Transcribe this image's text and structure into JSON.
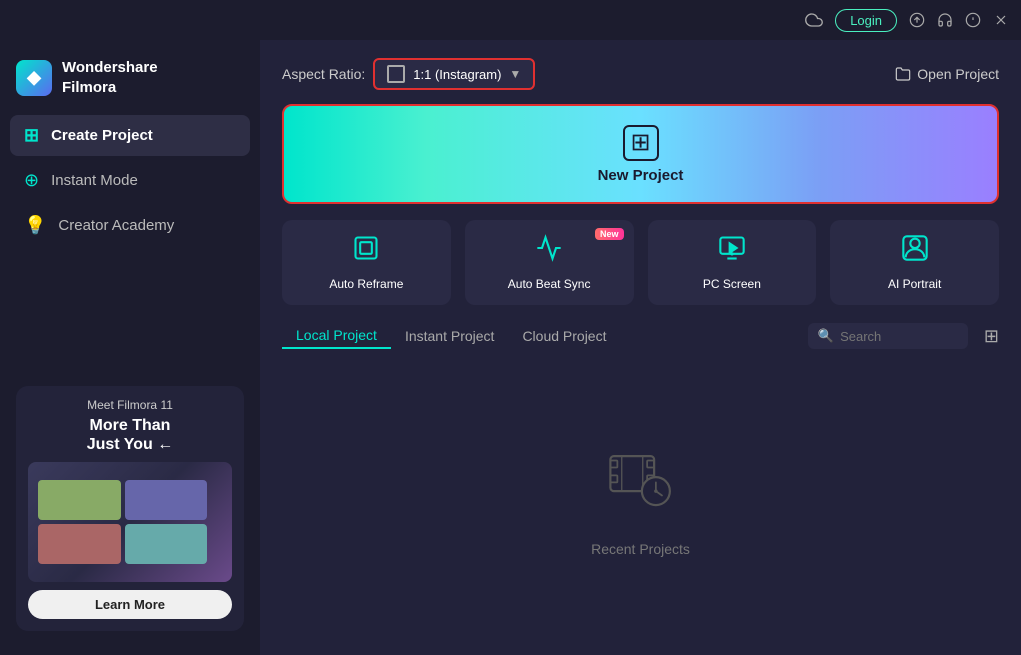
{
  "titlebar": {
    "login_label": "Login",
    "icons": [
      "cloud-icon",
      "upload-icon",
      "headset-icon",
      "alert-icon",
      "close-icon"
    ]
  },
  "sidebar": {
    "logo_text_line1": "Wondershare",
    "logo_text_line2": "Filmora",
    "nav_items": [
      {
        "id": "create-project",
        "label": "Create Project",
        "active": true
      },
      {
        "id": "instant-mode",
        "label": "Instant Mode",
        "active": false
      },
      {
        "id": "creator-academy",
        "label": "Creator Academy",
        "active": false
      }
    ],
    "promo": {
      "subtitle": "Meet Filmora 11",
      "headline": "More Than\nJust You",
      "learn_more_label": "Learn More"
    }
  },
  "content": {
    "aspect_ratio_label": "Aspect Ratio:",
    "aspect_ratio_value": "1:1 (Instagram)",
    "open_project_label": "Open Project",
    "new_project_label": "New Project",
    "quick_actions": [
      {
        "id": "auto-reframe",
        "label": "Auto Reframe",
        "icon": "reframe",
        "badge": null
      },
      {
        "id": "auto-beat-sync",
        "label": "Auto Beat Sync",
        "icon": "beat",
        "badge": "New"
      },
      {
        "id": "pc-screen",
        "label": "PC Screen",
        "icon": "screen",
        "badge": null
      },
      {
        "id": "ai-portrait",
        "label": "AI Portrait",
        "icon": "portrait",
        "badge": null
      }
    ],
    "project_tabs": [
      {
        "id": "local",
        "label": "Local Project",
        "active": true
      },
      {
        "id": "instant",
        "label": "Instant Project",
        "active": false
      },
      {
        "id": "cloud",
        "label": "Cloud Project",
        "active": false
      }
    ],
    "search_placeholder": "Search",
    "recent_projects_label": "Recent Projects"
  }
}
